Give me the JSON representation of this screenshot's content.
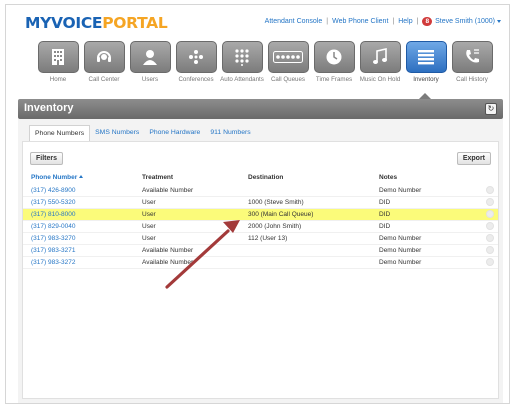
{
  "logo": {
    "part1": "MYVOICE",
    "part2": "PORTAL"
  },
  "topbar": {
    "links": [
      "Attendant Console",
      "Web Phone Client",
      "Help"
    ],
    "badge_count": "8",
    "user": "Steve Smith (1000)"
  },
  "nav": [
    {
      "label": "Home",
      "icon": "building-icon"
    },
    {
      "label": "Call Center",
      "icon": "headset-icon"
    },
    {
      "label": "Users",
      "icon": "user-icon"
    },
    {
      "label": "Conferences",
      "icon": "conference-icon"
    },
    {
      "label": "Auto Attendants",
      "icon": "keypad-icon"
    },
    {
      "label": "Call Queues",
      "icon": "queue-dots-icon"
    },
    {
      "label": "Time Frames",
      "icon": "clock-icon"
    },
    {
      "label": "Music On Hold",
      "icon": "music-note-icon"
    },
    {
      "label": "Inventory",
      "icon": "list-icon",
      "active": true
    },
    {
      "label": "Call History",
      "icon": "phone-history-icon"
    }
  ],
  "section": {
    "title": "Inventory"
  },
  "tabs": [
    "Phone Numbers",
    "SMS Numbers",
    "Phone Hardware",
    "911 Numbers"
  ],
  "buttons": {
    "filters": "Filters",
    "export": "Export"
  },
  "table": {
    "headers": [
      "Phone Number",
      "Treatment",
      "Destination",
      "Notes"
    ],
    "rows": [
      {
        "phone": "(317) 426-8900",
        "treatment": "Available Number",
        "destination": "",
        "notes": "Demo Number"
      },
      {
        "phone": "(317) 550-5320",
        "treatment": "User",
        "destination": "1000 (Steve Smith)",
        "notes": "DID"
      },
      {
        "phone": "(317) 810-8000",
        "treatment": "User",
        "destination": "300 (Main Call Queue)",
        "notes": "DID",
        "highlight": true
      },
      {
        "phone": "(317) 829-0040",
        "treatment": "User",
        "destination": "2000 (John Smith)",
        "notes": "DID"
      },
      {
        "phone": "(317) 983-3270",
        "treatment": "User",
        "destination": "112 (User 13)",
        "notes": "Demo Number"
      },
      {
        "phone": "(317) 983-3271",
        "treatment": "Available Number",
        "destination": "",
        "notes": "Demo Number"
      },
      {
        "phone": "(317) 983-3272",
        "treatment": "Available Number",
        "destination": "",
        "notes": "Demo Number"
      }
    ]
  },
  "colors": {
    "link": "#2576c6",
    "highlight": "#fbfb7a",
    "arrow": "#a33a3a",
    "active_tile": "#2d6fc0"
  }
}
